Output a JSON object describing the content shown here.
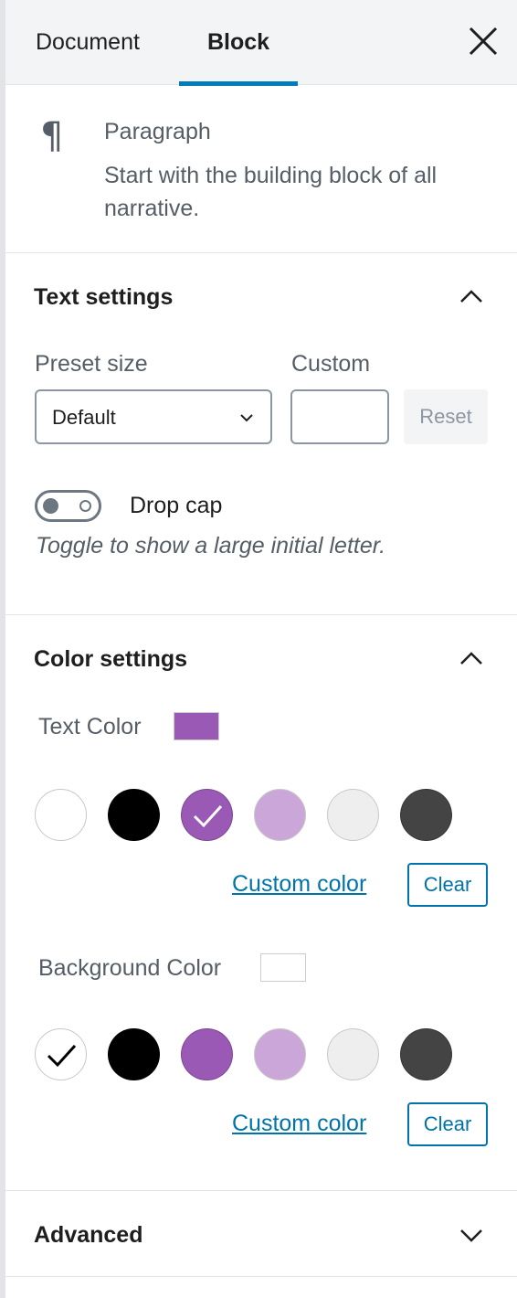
{
  "tabs": {
    "document": "Document",
    "block": "Block"
  },
  "block": {
    "icon": "paragraph-icon",
    "title": "Paragraph",
    "description": "Start with the building block of all narrative."
  },
  "text_settings": {
    "title": "Text settings",
    "preset_label": "Preset size",
    "preset_value": "Default",
    "custom_label": "Custom",
    "custom_value": "",
    "reset_label": "Reset",
    "dropcap_label": "Drop cap",
    "dropcap_help": "Toggle to show a large initial letter."
  },
  "color_settings": {
    "title": "Color settings",
    "text_color_label": "Text Color",
    "text_color_value": "#9b59b6",
    "background_color_label": "Background Color",
    "background_color_value": "#ffffff",
    "palette": [
      "#ffffff",
      "#000000",
      "#9b59b6",
      "#cba7d9",
      "#eeeeee",
      "#444444"
    ],
    "text_selected_index": 2,
    "background_selected_index": 0,
    "custom_color_label": "Custom color",
    "clear_label": "Clear"
  },
  "advanced": {
    "title": "Advanced"
  }
}
